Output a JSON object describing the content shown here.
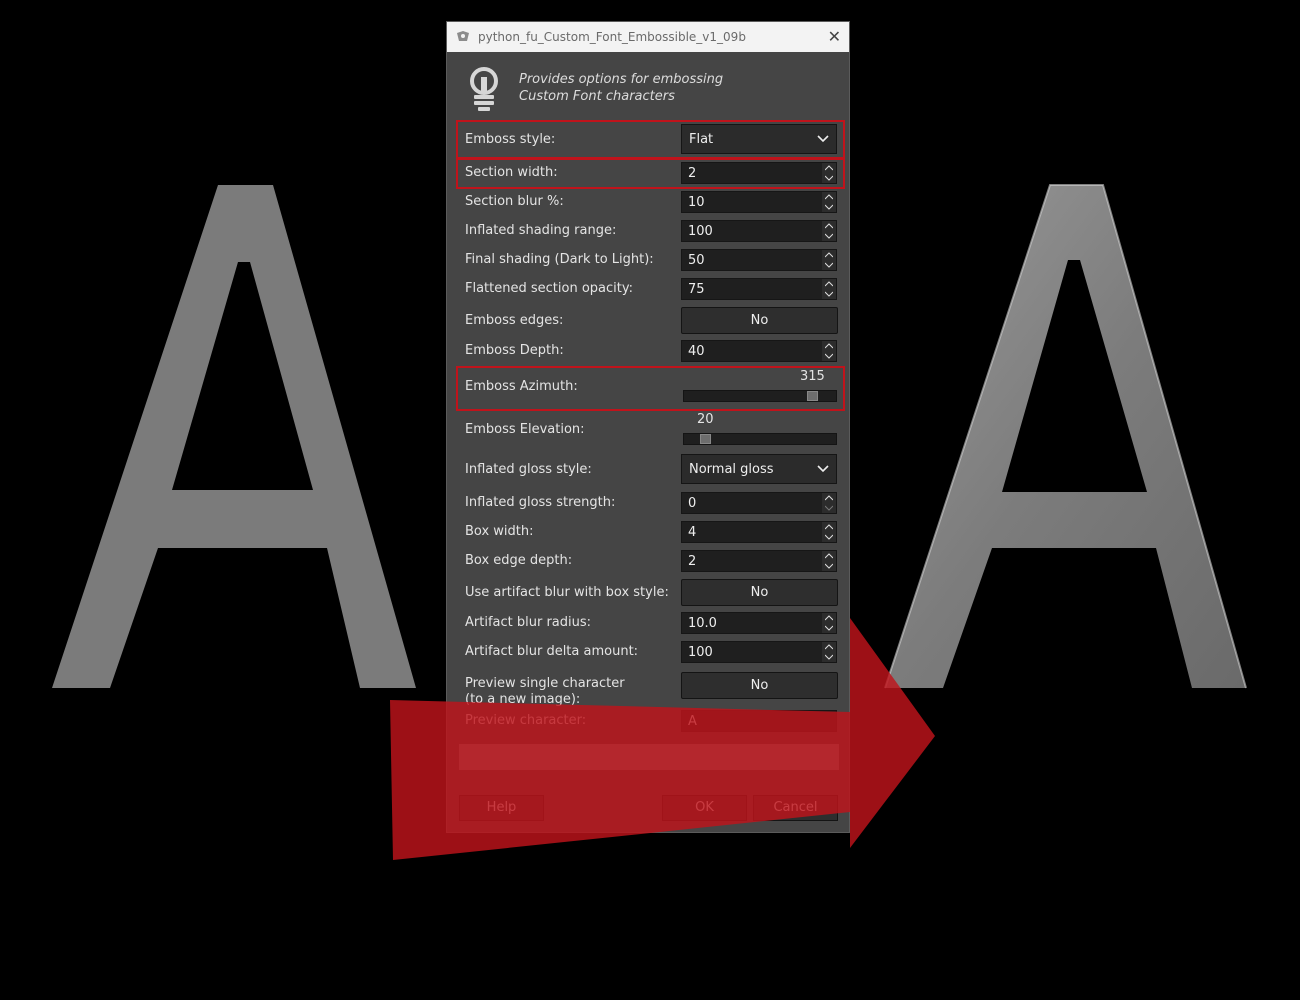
{
  "window": {
    "title": "python_fu_Custom_Font_Embossible_v1_09b",
    "close_glyph": "✕"
  },
  "header": {
    "line1": "Provides options for embossing",
    "line2": "Custom Font characters"
  },
  "fields": {
    "emboss_style": {
      "label": "Emboss style:",
      "value": "Flat"
    },
    "section_width": {
      "label": "Section width:",
      "value": "2"
    },
    "section_blur": {
      "label": "Section blur %:",
      "value": "10"
    },
    "inflated_shading_range": {
      "label": "Inflated shading range:",
      "value": "100"
    },
    "final_shading": {
      "label": "Final shading (Dark to Light):",
      "value": "50"
    },
    "flattened_opacity": {
      "label": "Flattened section opacity:",
      "value": "75"
    },
    "emboss_edges": {
      "label": "Emboss edges:",
      "value": "No"
    },
    "emboss_depth": {
      "label": "Emboss Depth:",
      "value": "40"
    },
    "emboss_azimuth": {
      "label": "Emboss Azimuth:",
      "value": "315",
      "fraction": 0.875
    },
    "emboss_elevation": {
      "label": "Emboss Elevation:",
      "value": "20",
      "fraction": 0.11
    },
    "inflated_gloss_style": {
      "label": "Inflated gloss style:",
      "value": "Normal gloss"
    },
    "inflated_gloss_strength": {
      "label": "Inflated gloss strength:",
      "value": "0"
    },
    "box_width": {
      "label": "Box width:",
      "value": "4"
    },
    "box_edge_depth": {
      "label": "Box edge depth:",
      "value": "2"
    },
    "artifact_blur_box": {
      "label": "Use artifact blur with box style:",
      "value": "No"
    },
    "artifact_blur_radius": {
      "label": "Artifact blur radius:",
      "value": "10.0"
    },
    "artifact_blur_delta": {
      "label": "Artifact blur delta amount:",
      "value": "100"
    },
    "preview_single": {
      "label_line1": "Preview single character",
      "label_line2": "(to a new image):",
      "value": "No"
    },
    "preview_character": {
      "label": "Preview character:",
      "value": "A"
    }
  },
  "buttons": {
    "help": "Help",
    "ok": "OK",
    "cancel": "Cancel"
  },
  "colors": {
    "highlight": "#c0131b",
    "arrow": "#c0131b"
  }
}
